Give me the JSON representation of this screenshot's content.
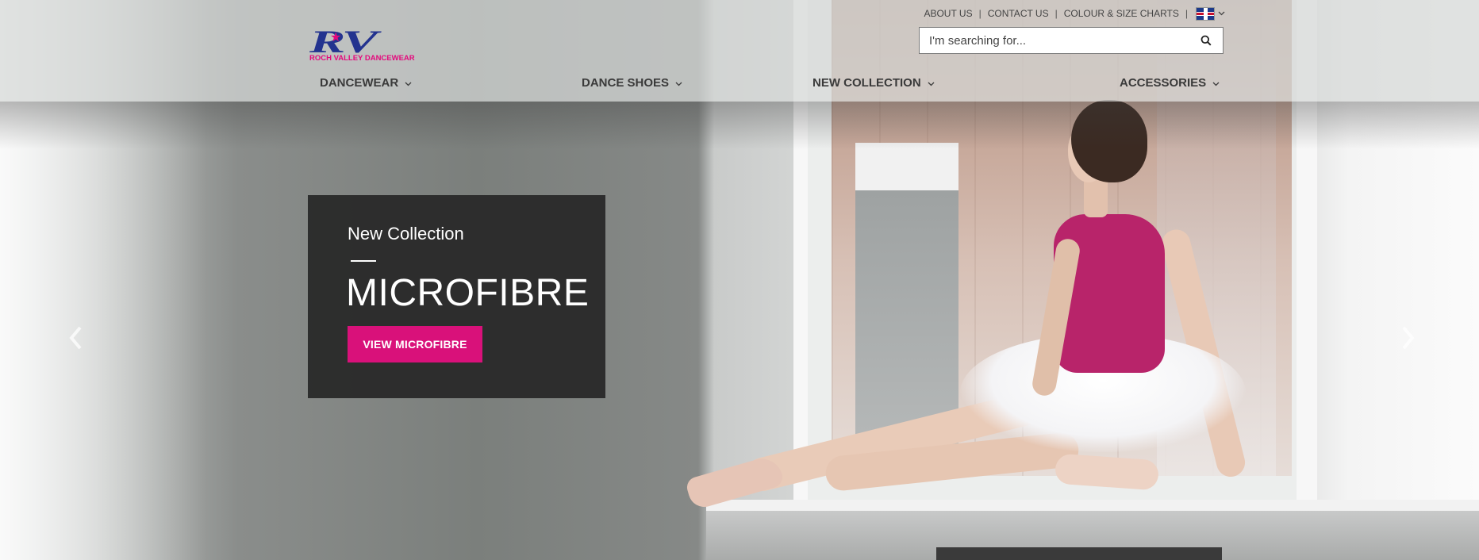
{
  "header": {
    "logo": {
      "letters": "RV",
      "wordmark": "ROCH VALLEY DANCEWEAR"
    },
    "top_links": [
      {
        "label": "ABOUT US"
      },
      {
        "label": "CONTACT US"
      },
      {
        "label": "COLOUR & SIZE CHARTS"
      }
    ],
    "language": {
      "icon": "uk-flag-icon"
    },
    "search": {
      "placeholder": "I'm searching for...",
      "value": ""
    },
    "nav": [
      {
        "label": "DANCEWEAR"
      },
      {
        "label": "DANCE SHOES"
      },
      {
        "label": "NEW COLLECTION"
      },
      {
        "label": "ACCESSORIES"
      }
    ]
  },
  "hero": {
    "kicker": "New Collection",
    "headline": "MICROFIBRE",
    "cta_label": "VIEW MICROFIBRE"
  },
  "colors": {
    "brand_blue": "#23338f",
    "brand_pink": "#e4097c",
    "cta_pink": "#d9117a",
    "caption_bg": "#262626"
  }
}
